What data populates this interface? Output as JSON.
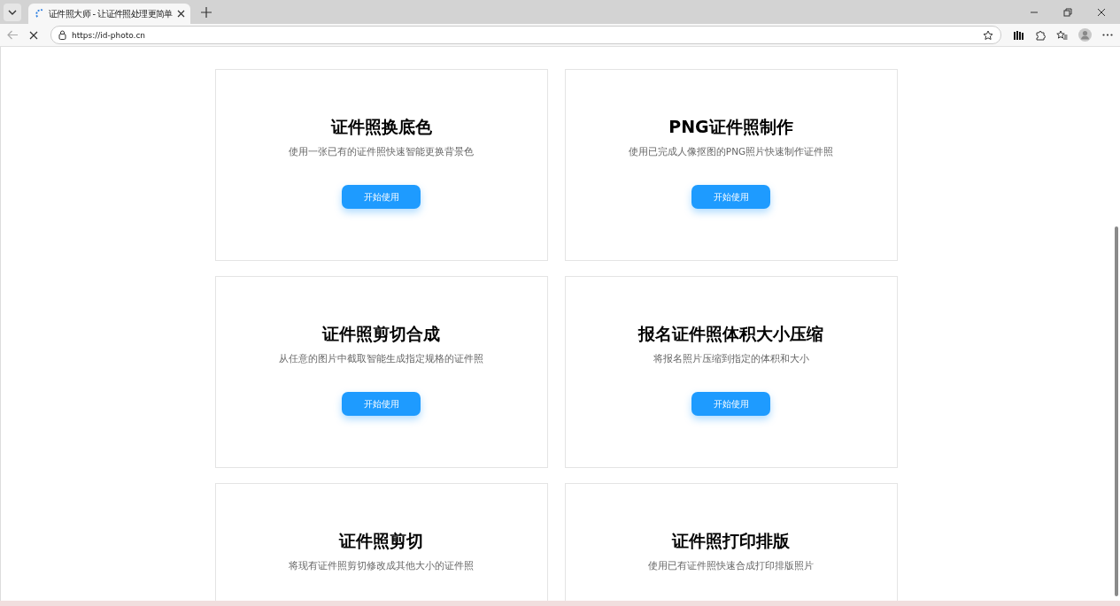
{
  "browser": {
    "tab_title": "证件照大师 - 让证件照处理更简单",
    "url": "https://id-photo.cn"
  },
  "cards": [
    {
      "title": "证件照换底色",
      "description": "使用一张已有的证件照快速智能更换背景色",
      "button": "开始使用"
    },
    {
      "title": "PNG证件照制作",
      "description": "使用已完成人像抠图的PNG照片快速制作证件照",
      "button": "开始使用"
    },
    {
      "title": "证件照剪切合成",
      "description": "从任意的图片中截取智能生成指定规格的证件照",
      "button": "开始使用"
    },
    {
      "title": "报名证件照体积大小压缩",
      "description": "将报名照片压缩到指定的体积和大小",
      "button": "开始使用"
    },
    {
      "title": "证件照剪切",
      "description": "将现有证件照剪切修改成其他大小的证件照"
    },
    {
      "title": "证件照打印排版",
      "description": "使用已有证件照快速合成打印排版照片"
    }
  ]
}
